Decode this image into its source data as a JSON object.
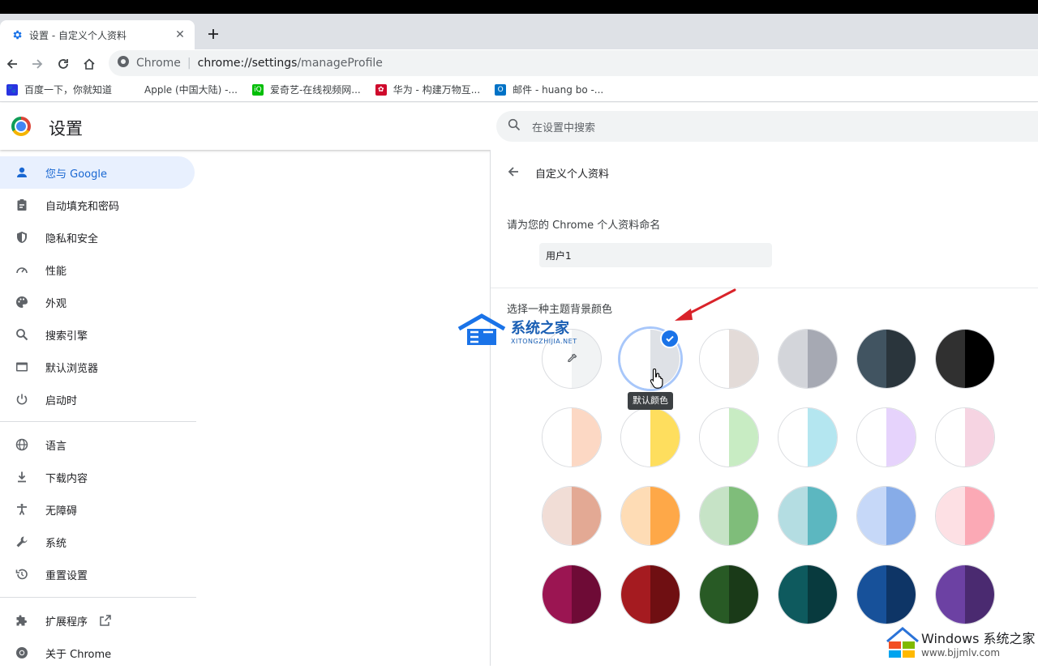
{
  "browser": {
    "tab_title": "设置 - 自定义个人资料",
    "omnibox_site": "Chrome",
    "omnibox_sep": "|",
    "url_host": "chrome://settings",
    "url_path": "/manageProfile"
  },
  "bookmarks": [
    {
      "label": "百度一下，你就知道",
      "color": "#2932e1",
      "glyph": "百"
    },
    {
      "label": "Apple (中国大陆) -...",
      "color": "#555555",
      "glyph": ""
    },
    {
      "label": "爱奇艺-在线视频网...",
      "color": "#00be06",
      "glyph": "iQ"
    },
    {
      "label": "华为 - 构建万物互...",
      "color": "#cf0a2c",
      "glyph": "H"
    },
    {
      "label": "邮件 - huang bo -...",
      "color": "#0072c6",
      "glyph": "O"
    }
  ],
  "header": {
    "title": "设置",
    "search_placeholder": "在设置中搜索"
  },
  "sidebar": {
    "items": [
      {
        "label": "您与 Google",
        "icon": "person-icon",
        "active": true
      },
      {
        "label": "自动填充和密码",
        "icon": "clipboard-icon"
      },
      {
        "label": "隐私和安全",
        "icon": "shield-icon"
      },
      {
        "label": "性能",
        "icon": "gauge-icon"
      },
      {
        "label": "外观",
        "icon": "palette-icon"
      },
      {
        "label": "搜索引擎",
        "icon": "search-icon"
      },
      {
        "label": "默认浏览器",
        "icon": "browser-icon"
      },
      {
        "label": "启动时",
        "icon": "power-icon"
      },
      {
        "label": "语言",
        "icon": "globe-icon"
      },
      {
        "label": "下载内容",
        "icon": "download-icon"
      },
      {
        "label": "无障碍",
        "icon": "accessibility-icon"
      },
      {
        "label": "系统",
        "icon": "wrench-icon"
      },
      {
        "label": "重置设置",
        "icon": "reset-icon"
      },
      {
        "label": "扩展程序",
        "icon": "puzzle-icon"
      },
      {
        "label": "关于 Chrome",
        "icon": "chrome-icon"
      }
    ]
  },
  "panel": {
    "title": "自定义个人资料",
    "name_label": "请为您的 Chrome 个人资料命名",
    "name_value": "用户1",
    "color_label": "选择一种主题背景颜色",
    "tooltip": "默认颜色"
  },
  "colors": {
    "accent": "#1a73e8",
    "active_bg": "#e8f0fe",
    "swatches": [
      [
        null,
        [
          "#ffffff",
          "#dee1e6"
        ],
        [
          "#ffffff",
          "#e3dbd8"
        ],
        [
          "#d3d5da",
          "#a6a9b3"
        ],
        [
          "#415461",
          "#2a353c"
        ],
        [
          "#303030",
          "#000000"
        ]
      ],
      [
        [
          "#ffffff",
          "#fcd8c4"
        ],
        [
          "#ffffff",
          "#fede5e"
        ],
        [
          "#ffffff",
          "#c8ecc3"
        ],
        [
          "#ffffff",
          "#b4e6f0"
        ],
        [
          "#ffffff",
          "#e6d3fc"
        ],
        [
          "#ffffff",
          "#f6d4e2"
        ]
      ],
      [
        [
          "#f1ddd6",
          "#e3a994"
        ],
        [
          "#fedcb5",
          "#fea848"
        ],
        [
          "#c6e3c6",
          "#7fbd7a"
        ],
        [
          "#b4dde2",
          "#5cb7c0"
        ],
        [
          "#c6d8f8",
          "#87ace8"
        ],
        [
          "#fde0e4",
          "#fba9b5"
        ]
      ],
      [
        [
          "#9b1552",
          "#6e0b36"
        ],
        [
          "#a51b20",
          "#6f0f12"
        ],
        [
          "#285a25",
          "#1a3a18"
        ],
        [
          "#0e5a5e",
          "#083a3e"
        ],
        [
          "#17519a",
          "#0e3566"
        ],
        [
          "#6c41a3",
          "#4a2a70"
        ]
      ]
    ]
  },
  "watermarks": {
    "site_cn": "系统之家",
    "site_en": "XITONGZHIJIA.NET",
    "windows": "Windows",
    "windows_cn": "系统之家",
    "windows_url": "www.bjjmlv.com"
  }
}
